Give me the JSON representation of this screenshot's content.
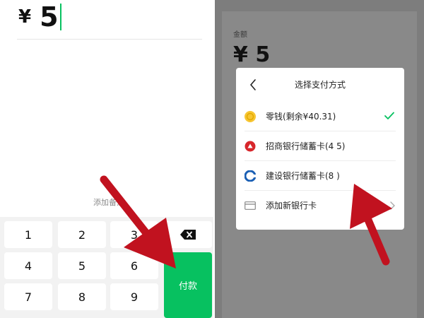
{
  "payment_screen": {
    "currency_symbol": "¥",
    "amount": "5",
    "add_note_label": "添加备注",
    "keypad": {
      "keys": [
        "1",
        "2",
        "3",
        "4",
        "5",
        "6",
        "7",
        "8",
        "9"
      ],
      "backspace_icon": "backspace-icon",
      "pay_label": "付款"
    }
  },
  "payment_method_dialog": {
    "background": {
      "amount_label": "金额",
      "amount": "¥ 5"
    },
    "title": "选择支付方式",
    "back_icon": "chevron-left-icon",
    "options": [
      {
        "label": "零钱(剩余¥40.31)",
        "icon": "coin-icon",
        "selected": true
      },
      {
        "label": "招商银行储蓄卡(4  5)",
        "icon": "cmb-bank-icon",
        "selected": false
      },
      {
        "label": "建设银行储蓄卡(8   )",
        "icon": "ccb-bank-icon",
        "selected": false
      },
      {
        "label": "添加新银行卡",
        "icon": "card-icon",
        "selected": false
      }
    ]
  },
  "colors": {
    "accent_green": "#07c160",
    "overlay_gray": "#7d7d7d",
    "arrow_red": "#c1121f"
  }
}
